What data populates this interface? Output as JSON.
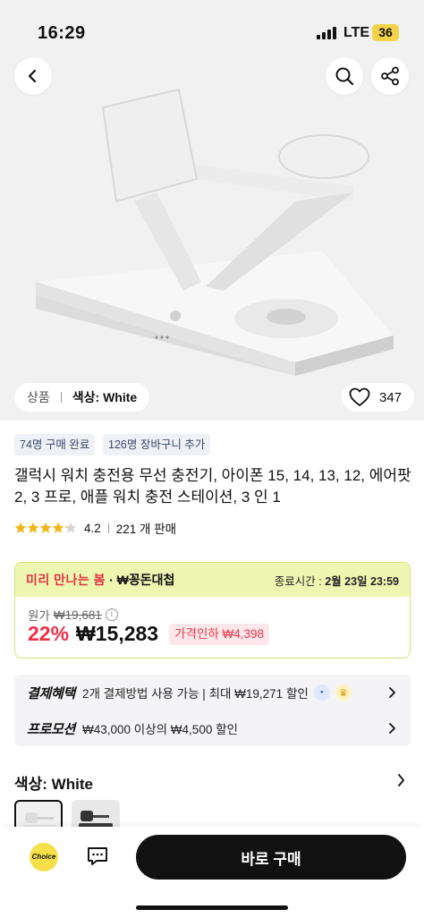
{
  "status_bar": {
    "time": "16:29",
    "network": "LTE",
    "battery": "36"
  },
  "header": {
    "back_icon": "chevron-left-icon",
    "search_icon": "search-icon",
    "share_icon": "share-icon"
  },
  "variant_pill": {
    "category": "상품",
    "selected": "색상: White"
  },
  "likes": {
    "count": "347"
  },
  "tags": [
    "74명 구매 완료",
    "126명 장바구니 추가"
  ],
  "product": {
    "title": "갤럭시 워치 충전용 무선 충전기, 아이폰 15, 14, 13, 12, 에어팟 2, 3 프로, 애플 워치 충전 스테이션, 3 인 1",
    "rating": "4.2",
    "rating_value": 4.2,
    "sold": "221 개 판매"
  },
  "deal": {
    "tag1": "미리 만나는 봄",
    "tag2": "· ₩꽁돈대첩",
    "end_label": "종료시간 : ",
    "end_time": "2월 23일 23:59",
    "original_label": "원가",
    "original_price": "₩19,681",
    "discount": "22%",
    "price": "₩15,283",
    "drop_label": "가격인하 ₩4,398"
  },
  "benefits": {
    "payment_label": "결제혜택",
    "payment_text": "2개 결제방법 사용 가능 | 최대 ₩19,271 할인",
    "promo_label": "프로모션",
    "promo_text": "₩43,000 이상의 ₩4,500 할인"
  },
  "color_section": {
    "label": "색상: White"
  },
  "bottom_bar": {
    "choice": "Choice",
    "buy_label": "바로 구매"
  },
  "colors": {
    "accent_red": "#ef2f4a",
    "deal_bg": "#eef7b2",
    "buy_bg": "#111111"
  }
}
